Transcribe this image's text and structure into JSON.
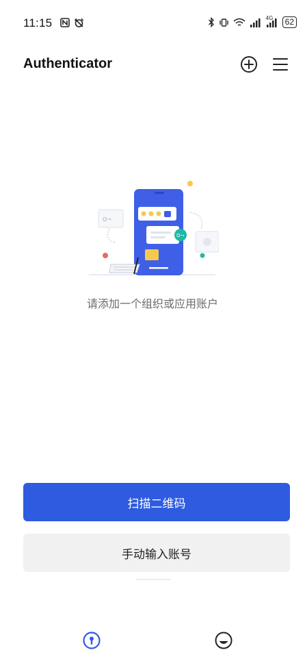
{
  "status_bar": {
    "time": "11:15",
    "battery": "62",
    "network_label": "4G"
  },
  "header": {
    "title": "Authenticator",
    "add_icon": "add-circle-icon",
    "menu_icon": "menu-icon"
  },
  "empty_state": {
    "message": "请添加一个组织或应用账户"
  },
  "actions": {
    "scan_label": "扫描二维码",
    "manual_label": "手动输入账号"
  },
  "bottom_nav": {
    "items": [
      {
        "icon": "key-tab-icon",
        "active": true
      },
      {
        "icon": "profile-tab-icon",
        "active": false
      }
    ]
  },
  "colors": {
    "primary": "#2e5be0",
    "secondary_bg": "#f1f1f1",
    "muted_text": "#6b6b6b",
    "accent_teal": "#1fb8a6",
    "accent_yellow": "#f5c94c",
    "accent_red": "#e86a5c"
  }
}
